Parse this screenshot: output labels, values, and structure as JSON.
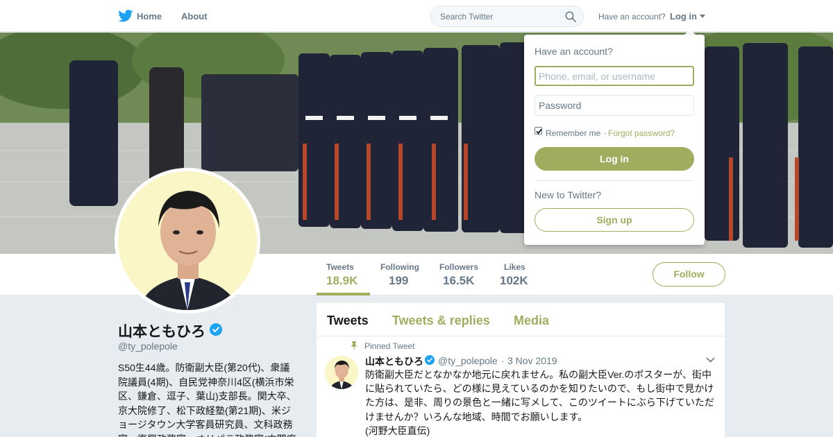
{
  "nav": {
    "home": "Home",
    "about": "About",
    "search_placeholder": "Search Twitter",
    "have_account": "Have an account?",
    "login": "Log in"
  },
  "profile": {
    "name": "山本ともひろ",
    "handle": "@ty_polepole",
    "bio": "S50生44歳。防衛副大臣(第20代)、衆議院議員(4期)、自民党神奈川4区(横浜市栄区、鎌倉、逗子、葉山)支部長。関大卒、京大院修了、松下政経塾(第21期)、米ジョージタウン大学客員研究員、文科政務官、復興政務官、オリパラ政務官(内閣府"
  },
  "stats": [
    {
      "label": "Tweets",
      "value": "18.9K"
    },
    {
      "label": "Following",
      "value": "199"
    },
    {
      "label": "Followers",
      "value": "16.5K"
    },
    {
      "label": "Likes",
      "value": "102K"
    }
  ],
  "follow_label": "Follow",
  "timeline": {
    "tabs": [
      "Tweets",
      "Tweets & replies",
      "Media"
    ],
    "pinned_label": "Pinned Tweet",
    "tweet": {
      "name": "山本ともひろ",
      "handle": "@ty_polepole",
      "dot": "·",
      "date": "3 Nov 2019",
      "lines": [
        "防衛副大臣だとなかなか地元に戻れません。私の副大臣Ver.のポスターが、街中",
        "に貼られていたら、どの様に見えているのかを知りたいので、もし街中で見かけ",
        "た方は、是非、周りの景色と一緒に写メして、このツイートにぶら下げていただ",
        "けませんか？いろんな地域、時間でお願いします。",
        "(河野大臣直伝)"
      ]
    }
  },
  "login_dropdown": {
    "heading": "Have an account?",
    "username_placeholder": "Phone, email, or username",
    "password_placeholder": "Password",
    "remember": "Remember me",
    "separator": "·",
    "forgot": "Forgot password?",
    "login_button": "Log in",
    "new_prompt": "New to Twitter?",
    "signup_button": "Sign up"
  },
  "colors": {
    "accent": "#a0ad5f",
    "twitter_blue": "#1da1f2",
    "secondary_text": "#657786"
  }
}
